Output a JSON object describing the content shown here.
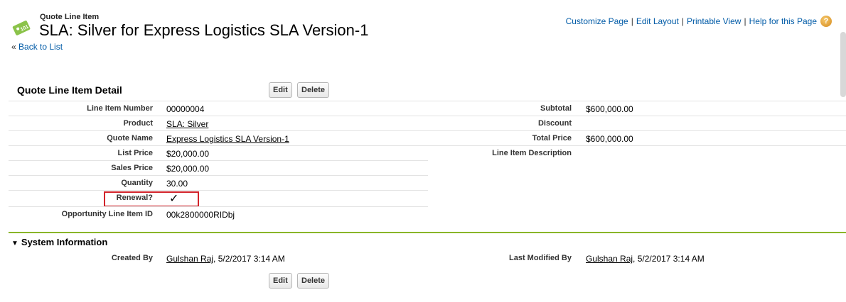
{
  "header": {
    "entity_label": "Quote Line Item",
    "title": "SLA: Silver for Express Logistics SLA Version-1",
    "back_link": "Back to List",
    "back_prefix": "«"
  },
  "top_links": {
    "customize": "Customize Page",
    "edit_layout": "Edit Layout",
    "printable": "Printable View",
    "help": "Help for this Page",
    "separator": "|",
    "help_icon": "?"
  },
  "detail": {
    "section_title": "Quote Line Item Detail",
    "edit_label": "Edit",
    "delete_label": "Delete",
    "left": [
      {
        "label": "Line Item Number",
        "value": "00000004"
      },
      {
        "label": "Product",
        "value": "SLA: Silver"
      },
      {
        "label": "Quote Name",
        "value": "Express Logistics SLA Version-1"
      },
      {
        "label": "List Price",
        "value": "$20,000.00"
      },
      {
        "label": "Sales Price",
        "value": "$20,000.00"
      },
      {
        "label": "Quantity",
        "value": "30.00"
      },
      {
        "label": "Renewal?",
        "value": "✓"
      },
      {
        "label": "Opportunity Line Item ID",
        "value": "00k2800000RIDbj"
      }
    ],
    "right": [
      {
        "label": "Subtotal",
        "value": "$600,000.00"
      },
      {
        "label": "Discount",
        "value": ""
      },
      {
        "label": "Total Price",
        "value": "$600,000.00"
      },
      {
        "label": "Line Item Description",
        "value": ""
      }
    ]
  },
  "system": {
    "section_title": "System Information",
    "created_by_label": "Created By",
    "created_by_user": "Gulshan Raj",
    "created_by_date": ", 5/2/2017 3:14 AM",
    "modified_by_label": "Last Modified By",
    "modified_by_user": "Gulshan Raj",
    "modified_by_date": ", 5/2/2017 3:14 AM",
    "edit_label": "Edit",
    "delete_label": "Delete"
  },
  "colors": {
    "link_blue": "#015ba7",
    "section_rule_green": "#8ab529",
    "highlight_red": "#d2232a"
  },
  "icons": [
    "price-tag-icon",
    "help-icon",
    "collapse-triangle-icon",
    "checkmark-icon"
  ]
}
